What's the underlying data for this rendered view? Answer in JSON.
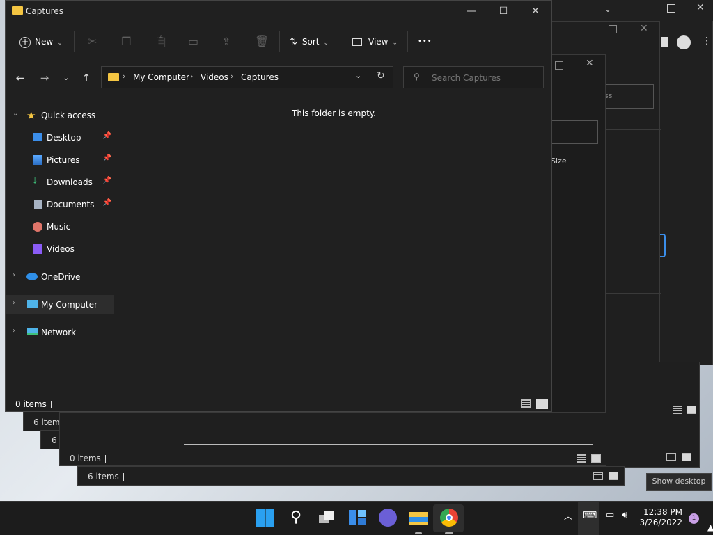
{
  "window": {
    "title": "Captures",
    "minimize_glyph": "—",
    "maximize_glyph": "☐",
    "close_glyph": "✕"
  },
  "toolbar": {
    "new_label": "New",
    "sort_label": "Sort",
    "view_label": "View",
    "more_glyph": "•••"
  },
  "address": {
    "crumbs": [
      "My Computer",
      "Videos",
      "Captures"
    ],
    "separator": "›"
  },
  "search": {
    "placeholder": "Search Captures"
  },
  "sidebar": {
    "quick_access": "Quick access",
    "items": [
      {
        "label": "Desktop",
        "icon": "desktop-icon"
      },
      {
        "label": "Pictures",
        "icon": "pictures-icon"
      },
      {
        "label": "Downloads",
        "icon": "downloads-icon"
      },
      {
        "label": "Documents",
        "icon": "documents-icon"
      },
      {
        "label": "Music",
        "icon": "music-icon"
      },
      {
        "label": "Videos",
        "icon": "videos-icon"
      }
    ],
    "onedrive": "OneDrive",
    "my_computer": "My Computer",
    "network": "Network",
    "pin_glyph": "📌"
  },
  "content": {
    "empty_message": "This folder is empty."
  },
  "status": {
    "item_count": "0 items"
  },
  "background": {
    "status_6_items": "6 items",
    "status_6_fragment": "6",
    "status_0_items": "0 items",
    "status_6_items_bottom": "6 items",
    "size_header": "Size",
    "ss_fragment": "ss"
  },
  "taskbar": {
    "time": "12:38 PM",
    "date": "3/26/2022",
    "notifications": "1",
    "show_desktop": "Show desktop"
  },
  "colors": {
    "window_bg": "#202020",
    "accent_blue": "#3b8eea",
    "folder_yellow": "#f4c542",
    "taskbar_bg": "#1c1c1c"
  }
}
